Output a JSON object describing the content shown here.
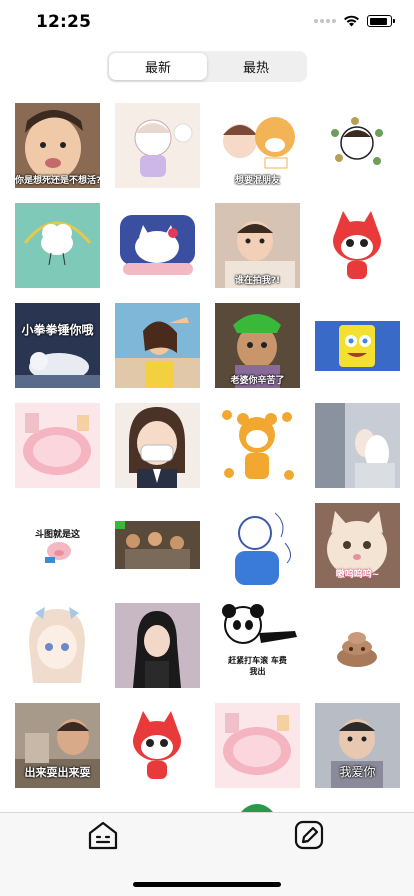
{
  "status_bar": {
    "time": "12:25",
    "battery_level": 0.85
  },
  "segmented_control": {
    "options": [
      {
        "label": "最新",
        "selected": true
      },
      {
        "label": "最热",
        "selected": false
      }
    ]
  },
  "stickers": [
    {
      "caption": "你是想死还是不想活?"
    },
    {
      "caption": ""
    },
    {
      "caption": "想要混朋友"
    },
    {
      "caption": ""
    },
    {
      "caption": ""
    },
    {
      "caption": ""
    },
    {
      "caption": "谁在拍我?!"
    },
    {
      "caption": ""
    },
    {
      "caption": "小拳拳锤你哦"
    },
    {
      "caption": ""
    },
    {
      "caption": "老婆你辛苦了"
    },
    {
      "caption": ""
    },
    {
      "caption": ""
    },
    {
      "caption": ""
    },
    {
      "caption": ""
    },
    {
      "caption": ""
    },
    {
      "caption": "斗图就是这"
    },
    {
      "caption": ""
    },
    {
      "caption": ""
    },
    {
      "caption": "嗷呜呜呜~"
    },
    {
      "caption": ""
    },
    {
      "caption": ""
    },
    {
      "caption": "赶紧打车滚 车费我出"
    },
    {
      "caption": ""
    },
    {
      "caption": "出来耍出来耍"
    },
    {
      "caption": ""
    },
    {
      "caption": ""
    },
    {
      "caption": "我爱你"
    }
  ],
  "tab_bar": {
    "items": [
      {
        "icon": "home-face-icon"
      },
      {
        "icon": "edit-square-icon"
      }
    ]
  }
}
